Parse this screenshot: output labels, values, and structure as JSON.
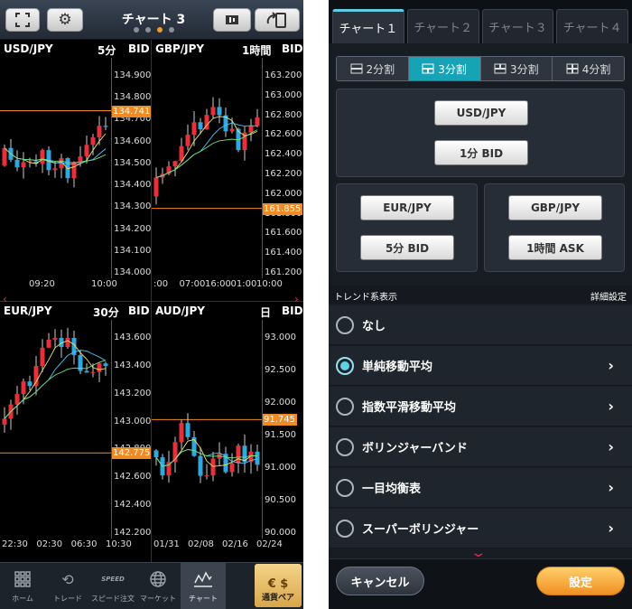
{
  "left": {
    "title": "チャート 3",
    "page_dots": 4,
    "active_dot": 2,
    "panels": [
      {
        "pair": "USD/JPY",
        "period": "5分",
        "side": "BID",
        "price_labels": [
          "134.900",
          "134.800",
          "134.700",
          "134.600",
          "134.500",
          "134.400",
          "134.300",
          "134.200",
          "134.100",
          "134.000"
        ],
        "current_price": "134.741",
        "time_labels": [
          "09:20",
          "10:00"
        ],
        "y_range": [
          134.0,
          134.9
        ]
      },
      {
        "pair": "GBP/JPY",
        "period": "1時間",
        "side": "BID",
        "price_labels": [
          "163.200",
          "163.000",
          "162.800",
          "162.600",
          "162.400",
          "162.200",
          "162.000",
          "161.800",
          "161.600",
          "161.400",
          "161.200"
        ],
        "current_price": "161.855",
        "time_labels": [
          ":00",
          "07:00",
          "16:00",
          "01:00",
          "10:00"
        ],
        "y_range": [
          161.2,
          163.2
        ]
      },
      {
        "pair": "EUR/JPY",
        "period": "30分",
        "side": "BID",
        "price_labels": [
          "143.600",
          "143.400",
          "143.200",
          "143.000",
          "142.800",
          "142.600",
          "142.400",
          "142.200"
        ],
        "current_price": "142.775",
        "time_labels": [
          "22:30",
          "02:30",
          "06:30",
          "10:30"
        ],
        "y_range": [
          142.2,
          143.6
        ]
      },
      {
        "pair": "AUD/JPY",
        "period": "日",
        "side": "BID",
        "price_labels": [
          "93.000",
          "92.500",
          "92.000",
          "91.500",
          "91.000",
          "90.500",
          "90.000"
        ],
        "current_price": "91.745",
        "time_labels": [
          "01/31",
          "02/08",
          "02/16",
          "02/24"
        ],
        "y_range": [
          90.0,
          93.0
        ]
      }
    ],
    "nav": [
      {
        "label": "ホーム",
        "icon": "home-grid-icon"
      },
      {
        "label": "トレード",
        "icon": "trade-refresh-icon"
      },
      {
        "label": "スピード注文",
        "icon": "speed-order-icon",
        "icon_text": "SPEED"
      },
      {
        "label": "マーケット",
        "icon": "market-globe-icon"
      },
      {
        "label": "チャート",
        "icon": "chart-icon",
        "active": true
      }
    ],
    "pair_button": {
      "label": "通貨ペア",
      "icon_text": "€ $"
    }
  },
  "right": {
    "tabs": [
      "チャート１",
      "チャート２",
      "チャート３",
      "チャート４"
    ],
    "active_tab": 0,
    "split_options": [
      "2分割",
      "3分割",
      "3分割",
      "4分割"
    ],
    "active_split": 1,
    "slot1": {
      "pair": "USD/JPY",
      "period": "1分 BID"
    },
    "slot2": {
      "pair": "EUR/JPY",
      "period": "5分 BID"
    },
    "slot3": {
      "pair": "GBP/JPY",
      "period": "1時間 ASK"
    },
    "section_title": "トレンド系表示",
    "detail_settings": "詳細設定",
    "trend_options": [
      {
        "label": "なし",
        "selected": false,
        "has_chevron": false
      },
      {
        "label": "単純移動平均",
        "selected": true,
        "has_chevron": true
      },
      {
        "label": "指数平滑移動平均",
        "selected": false,
        "has_chevron": true
      },
      {
        "label": "ボリンジャーバンド",
        "selected": false,
        "has_chevron": true
      },
      {
        "label": "一目均衡表",
        "selected": false,
        "has_chevron": true
      },
      {
        "label": "スーパーボリンジャー",
        "selected": false,
        "has_chevron": true
      }
    ],
    "cancel_label": "キャンセル",
    "ok_label": "設定"
  },
  "colors": {
    "up": "#e8303a",
    "down": "#2fa8e0",
    "accent": "#f08a24",
    "teal": "#16a3b5"
  }
}
